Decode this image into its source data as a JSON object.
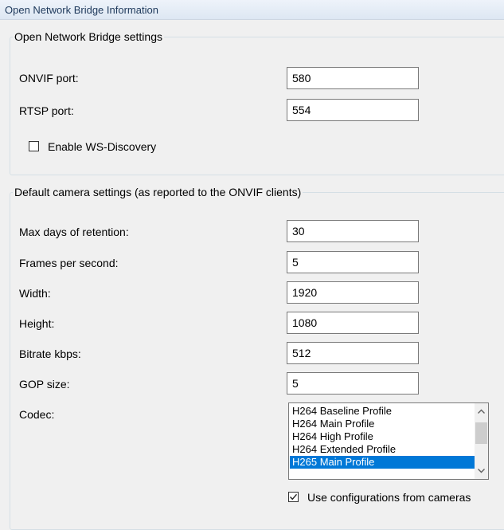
{
  "window": {
    "title": "Open Network Bridge Information"
  },
  "bridge_settings": {
    "legend": "Open Network Bridge settings",
    "onvif_port": {
      "label": "ONVIF port:",
      "value": "580"
    },
    "rtsp_port": {
      "label": "RTSP port:",
      "value": "554"
    },
    "ws_discovery": {
      "label": "Enable WS-Discovery",
      "checked": false
    }
  },
  "camera_settings": {
    "legend": "Default camera settings (as reported to the ONVIF clients)",
    "max_days": {
      "label": "Max days of retention:",
      "value": "30"
    },
    "fps": {
      "label": "Frames per second:",
      "value": "5"
    },
    "width": {
      "label": "Width:",
      "value": "1920"
    },
    "height": {
      "label": "Height:",
      "value": "1080"
    },
    "bitrate": {
      "label": "Bitrate kbps:",
      "value": "512"
    },
    "gop": {
      "label": "GOP size:",
      "value": "5"
    },
    "codec": {
      "label": "Codec:",
      "options": [
        "H264 Baseline Profile",
        "H264 Main Profile",
        "H264 High Profile",
        "H264 Extended Profile",
        "H265 Main Profile"
      ],
      "selected": "H265 Main Profile"
    },
    "use_camera_configs": {
      "label": "Use configurations from cameras",
      "checked": true
    }
  },
  "colors": {
    "selection": "#0078d7",
    "window_bg": "#f0f0f0"
  }
}
